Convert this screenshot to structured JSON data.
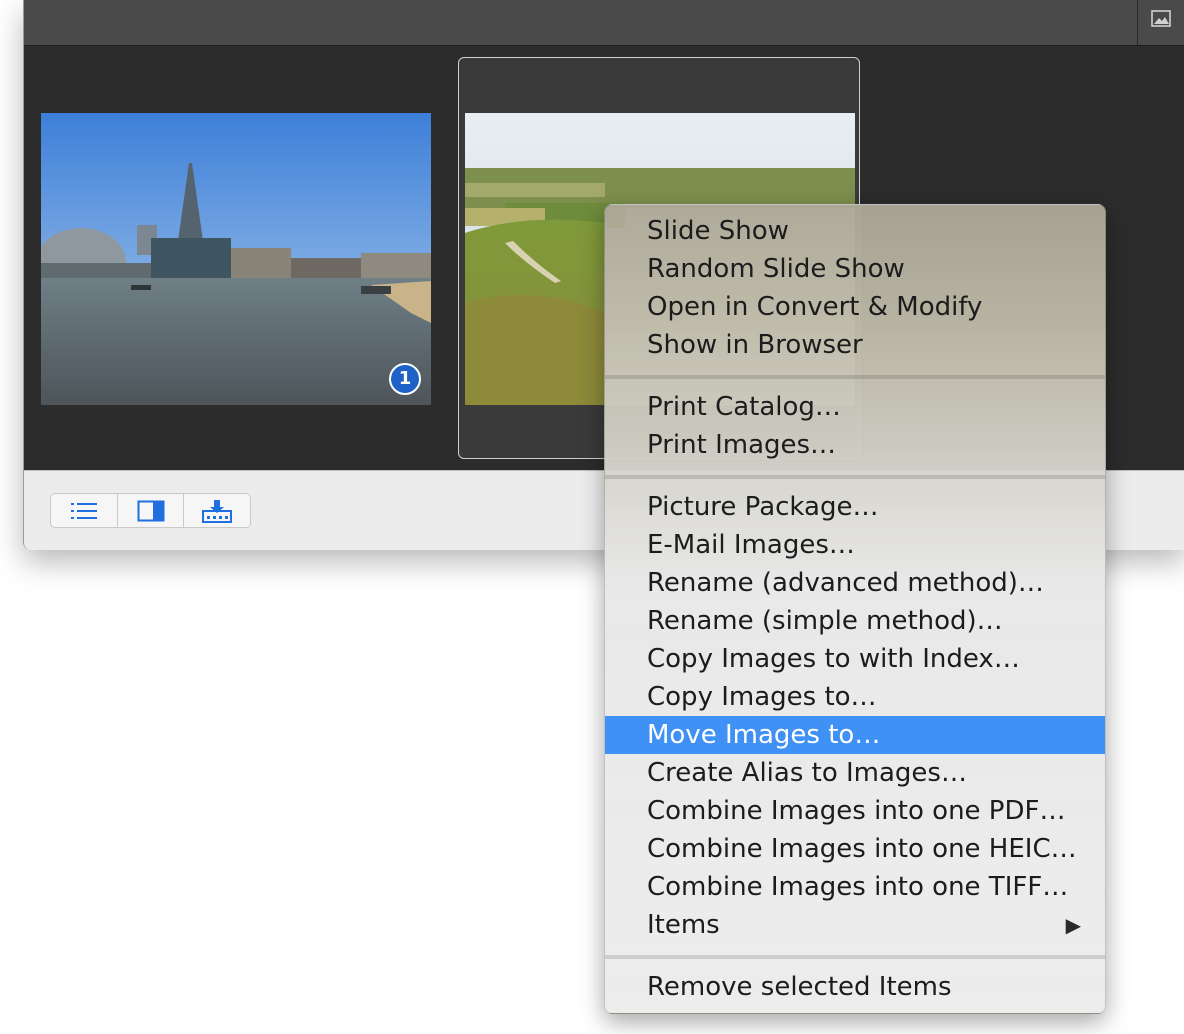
{
  "topbar": {
    "view_icon": "image-view-icon"
  },
  "thumbnails": [
    {
      "name": "london-thames-shard",
      "badge": "1",
      "selected": false
    },
    {
      "name": "countryside-hill-view",
      "badge": "",
      "selected": true
    }
  ],
  "bottombar": {
    "buttons": [
      "list-view-icon",
      "preview-pane-icon",
      "import-tray-icon"
    ]
  },
  "context_menu": {
    "groups": [
      [
        "Slide Show",
        "Random Slide Show",
        "Open in Convert & Modify",
        "Show in Browser"
      ],
      [
        "Print Catalog...",
        "Print Images..."
      ],
      [
        "Picture Package...",
        "E-Mail Images...",
        "Rename (advanced method)...",
        "Rename (simple method)...",
        "Copy Images to with Index...",
        "Copy Images to...",
        "Move Images to...",
        "Create Alias to Images...",
        "Combine Images into one PDF...",
        "Combine Images into one HEIC...",
        "Combine Images into one TIFF...",
        "Items"
      ],
      [
        "Remove selected Items"
      ]
    ],
    "items": {
      "slide_show": "Slide Show",
      "random_slide_show": "Random Slide Show",
      "open_convert_modify": "Open in Convert & Modify",
      "show_in_browser": "Show in Browser",
      "print_catalog": "Print Catalog…",
      "print_images": "Print Images…",
      "picture_package": "Picture Package…",
      "email_images": "E-Mail Images…",
      "rename_advanced": "Rename (advanced method)…",
      "rename_simple": "Rename (simple method)…",
      "copy_with_index": "Copy Images to with Index…",
      "copy_images": "Copy Images to…",
      "move_images": "Move Images to…",
      "create_alias": "Create Alias to Images…",
      "combine_pdf": "Combine Images into one PDF…",
      "combine_heic": "Combine Images into one HEIC…",
      "combine_tiff": "Combine Images into one TIFF…",
      "items": "Items",
      "remove_selected": "Remove selected Items"
    },
    "highlighted": "Move Images to…",
    "submenu_icon": "submenu-arrow-icon",
    "highlight_color": "#3f91f6"
  }
}
